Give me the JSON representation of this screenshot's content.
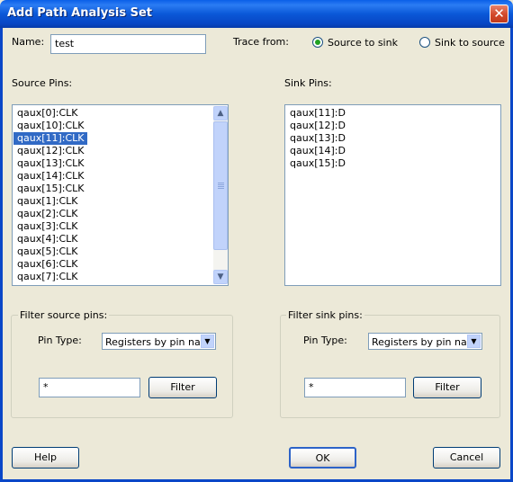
{
  "window": {
    "title": "Add Path Analysis Set"
  },
  "name_field": {
    "label": "Name:",
    "value": "test"
  },
  "trace_from": {
    "label": "Trace from:",
    "options": [
      {
        "label": "Source to sink",
        "selected": true
      },
      {
        "label": "Sink to source",
        "selected": false
      }
    ]
  },
  "source_pins": {
    "label": "Source Pins:",
    "items": [
      "qaux[0]:CLK",
      "qaux[10]:CLK",
      "qaux[11]:CLK",
      "qaux[12]:CLK",
      "qaux[13]:CLK",
      "qaux[14]:CLK",
      "qaux[15]:CLK",
      "qaux[1]:CLK",
      "qaux[2]:CLK",
      "qaux[3]:CLK",
      "qaux[4]:CLK",
      "qaux[5]:CLK",
      "qaux[6]:CLK",
      "qaux[7]:CLK"
    ],
    "selected": "qaux[11]:CLK"
  },
  "sink_pins": {
    "label": "Sink Pins:",
    "items": [
      "qaux[11]:D",
      "qaux[12]:D",
      "qaux[13]:D",
      "qaux[14]:D",
      "qaux[15]:D"
    ]
  },
  "filter_source": {
    "legend": "Filter source pins:",
    "pin_type_label": "Pin Type:",
    "pin_type_value": "Registers by pin name",
    "filter_value": "*",
    "filter_button": "Filter"
  },
  "filter_sink": {
    "legend": "Filter sink pins:",
    "pin_type_label": "Pin Type:",
    "pin_type_value": "Registers by pin name",
    "filter_value": "*",
    "filter_button": "Filter"
  },
  "buttons": {
    "help": "Help",
    "ok": "OK",
    "cancel": "Cancel"
  },
  "icons": {
    "close": "close-icon",
    "scroll_up": "scroll-up-arrow-icon",
    "scroll_down": "scroll-down-arrow-icon",
    "dropdown": "chevron-down-icon"
  }
}
